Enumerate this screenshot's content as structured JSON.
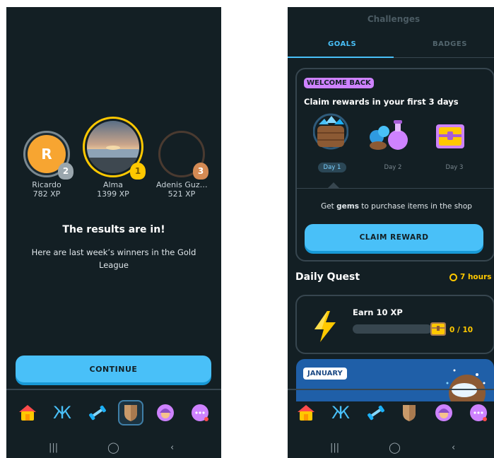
{
  "left_screen": {
    "winners": [
      {
        "rank": "2",
        "initial": "R",
        "name": "Ricardo",
        "xp": "782 XP"
      },
      {
        "rank": "1",
        "initial": "",
        "name": "Alma",
        "xp": "1399 XP"
      },
      {
        "rank": "3",
        "initial": "",
        "name": "Adenis Guz…",
        "xp": "521 XP"
      }
    ],
    "headline": "The results are in!",
    "subline": "Here are last week’s winners in the Gold League",
    "continue_label": "CONTINUE",
    "nav_icons": [
      "home-icon",
      "letters-icon",
      "dumbbell-icon",
      "shield-icon",
      "profile-icon",
      "more-icon"
    ],
    "active_nav": "shield-icon"
  },
  "right_screen": {
    "title": "Challenges",
    "tabs": [
      {
        "label": "GOALS",
        "active": true
      },
      {
        "label": "BADGES",
        "active": false
      }
    ],
    "welcome_badge": "WELCOME BACK",
    "claim_title": "Claim rewards in your first 3 days",
    "days": [
      "Day 1",
      "Day 2",
      "Day 3"
    ],
    "gems_prefix": "Get ",
    "gems_word": "gems",
    "gems_suffix": " to purchase items in the shop",
    "claim_button": "CLAIM REWARD",
    "daily_quest_title": "Daily Quest",
    "timer": "7 hours",
    "quest_label": "Earn 10 XP",
    "quest_progress_text": "0 / 10",
    "quest_progress_fraction": 0,
    "january_label": "JANUARY",
    "nav_icons": [
      "home-icon",
      "letters-icon",
      "dumbbell-icon",
      "shield-icon",
      "profile-icon",
      "more-icon"
    ]
  },
  "colors": {
    "background": "#131f24",
    "accent": "#49c0f8",
    "gold": "#ffc800",
    "purple": "#ce82ff"
  }
}
